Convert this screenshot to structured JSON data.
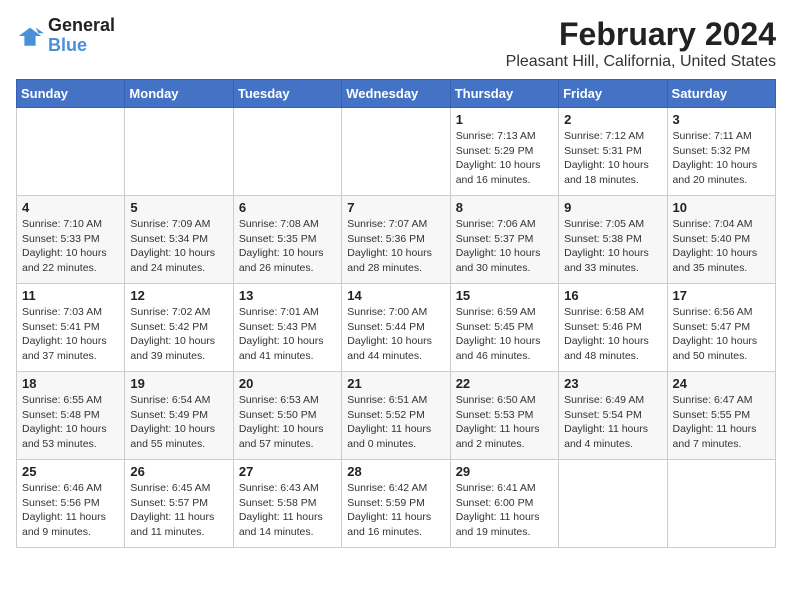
{
  "header": {
    "logo_line1": "General",
    "logo_line2": "Blue",
    "month_year": "February 2024",
    "location": "Pleasant Hill, California, United States"
  },
  "days_of_week": [
    "Sunday",
    "Monday",
    "Tuesday",
    "Wednesday",
    "Thursday",
    "Friday",
    "Saturday"
  ],
  "weeks": [
    [
      {
        "num": "",
        "info": ""
      },
      {
        "num": "",
        "info": ""
      },
      {
        "num": "",
        "info": ""
      },
      {
        "num": "",
        "info": ""
      },
      {
        "num": "1",
        "info": "Sunrise: 7:13 AM\nSunset: 5:29 PM\nDaylight: 10 hours\nand 16 minutes."
      },
      {
        "num": "2",
        "info": "Sunrise: 7:12 AM\nSunset: 5:31 PM\nDaylight: 10 hours\nand 18 minutes."
      },
      {
        "num": "3",
        "info": "Sunrise: 7:11 AM\nSunset: 5:32 PM\nDaylight: 10 hours\nand 20 minutes."
      }
    ],
    [
      {
        "num": "4",
        "info": "Sunrise: 7:10 AM\nSunset: 5:33 PM\nDaylight: 10 hours\nand 22 minutes."
      },
      {
        "num": "5",
        "info": "Sunrise: 7:09 AM\nSunset: 5:34 PM\nDaylight: 10 hours\nand 24 minutes."
      },
      {
        "num": "6",
        "info": "Sunrise: 7:08 AM\nSunset: 5:35 PM\nDaylight: 10 hours\nand 26 minutes."
      },
      {
        "num": "7",
        "info": "Sunrise: 7:07 AM\nSunset: 5:36 PM\nDaylight: 10 hours\nand 28 minutes."
      },
      {
        "num": "8",
        "info": "Sunrise: 7:06 AM\nSunset: 5:37 PM\nDaylight: 10 hours\nand 30 minutes."
      },
      {
        "num": "9",
        "info": "Sunrise: 7:05 AM\nSunset: 5:38 PM\nDaylight: 10 hours\nand 33 minutes."
      },
      {
        "num": "10",
        "info": "Sunrise: 7:04 AM\nSunset: 5:40 PM\nDaylight: 10 hours\nand 35 minutes."
      }
    ],
    [
      {
        "num": "11",
        "info": "Sunrise: 7:03 AM\nSunset: 5:41 PM\nDaylight: 10 hours\nand 37 minutes."
      },
      {
        "num": "12",
        "info": "Sunrise: 7:02 AM\nSunset: 5:42 PM\nDaylight: 10 hours\nand 39 minutes."
      },
      {
        "num": "13",
        "info": "Sunrise: 7:01 AM\nSunset: 5:43 PM\nDaylight: 10 hours\nand 41 minutes."
      },
      {
        "num": "14",
        "info": "Sunrise: 7:00 AM\nSunset: 5:44 PM\nDaylight: 10 hours\nand 44 minutes."
      },
      {
        "num": "15",
        "info": "Sunrise: 6:59 AM\nSunset: 5:45 PM\nDaylight: 10 hours\nand 46 minutes."
      },
      {
        "num": "16",
        "info": "Sunrise: 6:58 AM\nSunset: 5:46 PM\nDaylight: 10 hours\nand 48 minutes."
      },
      {
        "num": "17",
        "info": "Sunrise: 6:56 AM\nSunset: 5:47 PM\nDaylight: 10 hours\nand 50 minutes."
      }
    ],
    [
      {
        "num": "18",
        "info": "Sunrise: 6:55 AM\nSunset: 5:48 PM\nDaylight: 10 hours\nand 53 minutes."
      },
      {
        "num": "19",
        "info": "Sunrise: 6:54 AM\nSunset: 5:49 PM\nDaylight: 10 hours\nand 55 minutes."
      },
      {
        "num": "20",
        "info": "Sunrise: 6:53 AM\nSunset: 5:50 PM\nDaylight: 10 hours\nand 57 minutes."
      },
      {
        "num": "21",
        "info": "Sunrise: 6:51 AM\nSunset: 5:52 PM\nDaylight: 11 hours\nand 0 minutes."
      },
      {
        "num": "22",
        "info": "Sunrise: 6:50 AM\nSunset: 5:53 PM\nDaylight: 11 hours\nand 2 minutes."
      },
      {
        "num": "23",
        "info": "Sunrise: 6:49 AM\nSunset: 5:54 PM\nDaylight: 11 hours\nand 4 minutes."
      },
      {
        "num": "24",
        "info": "Sunrise: 6:47 AM\nSunset: 5:55 PM\nDaylight: 11 hours\nand 7 minutes."
      }
    ],
    [
      {
        "num": "25",
        "info": "Sunrise: 6:46 AM\nSunset: 5:56 PM\nDaylight: 11 hours\nand 9 minutes."
      },
      {
        "num": "26",
        "info": "Sunrise: 6:45 AM\nSunset: 5:57 PM\nDaylight: 11 hours\nand 11 minutes."
      },
      {
        "num": "27",
        "info": "Sunrise: 6:43 AM\nSunset: 5:58 PM\nDaylight: 11 hours\nand 14 minutes."
      },
      {
        "num": "28",
        "info": "Sunrise: 6:42 AM\nSunset: 5:59 PM\nDaylight: 11 hours\nand 16 minutes."
      },
      {
        "num": "29",
        "info": "Sunrise: 6:41 AM\nSunset: 6:00 PM\nDaylight: 11 hours\nand 19 minutes."
      },
      {
        "num": "",
        "info": ""
      },
      {
        "num": "",
        "info": ""
      }
    ]
  ]
}
